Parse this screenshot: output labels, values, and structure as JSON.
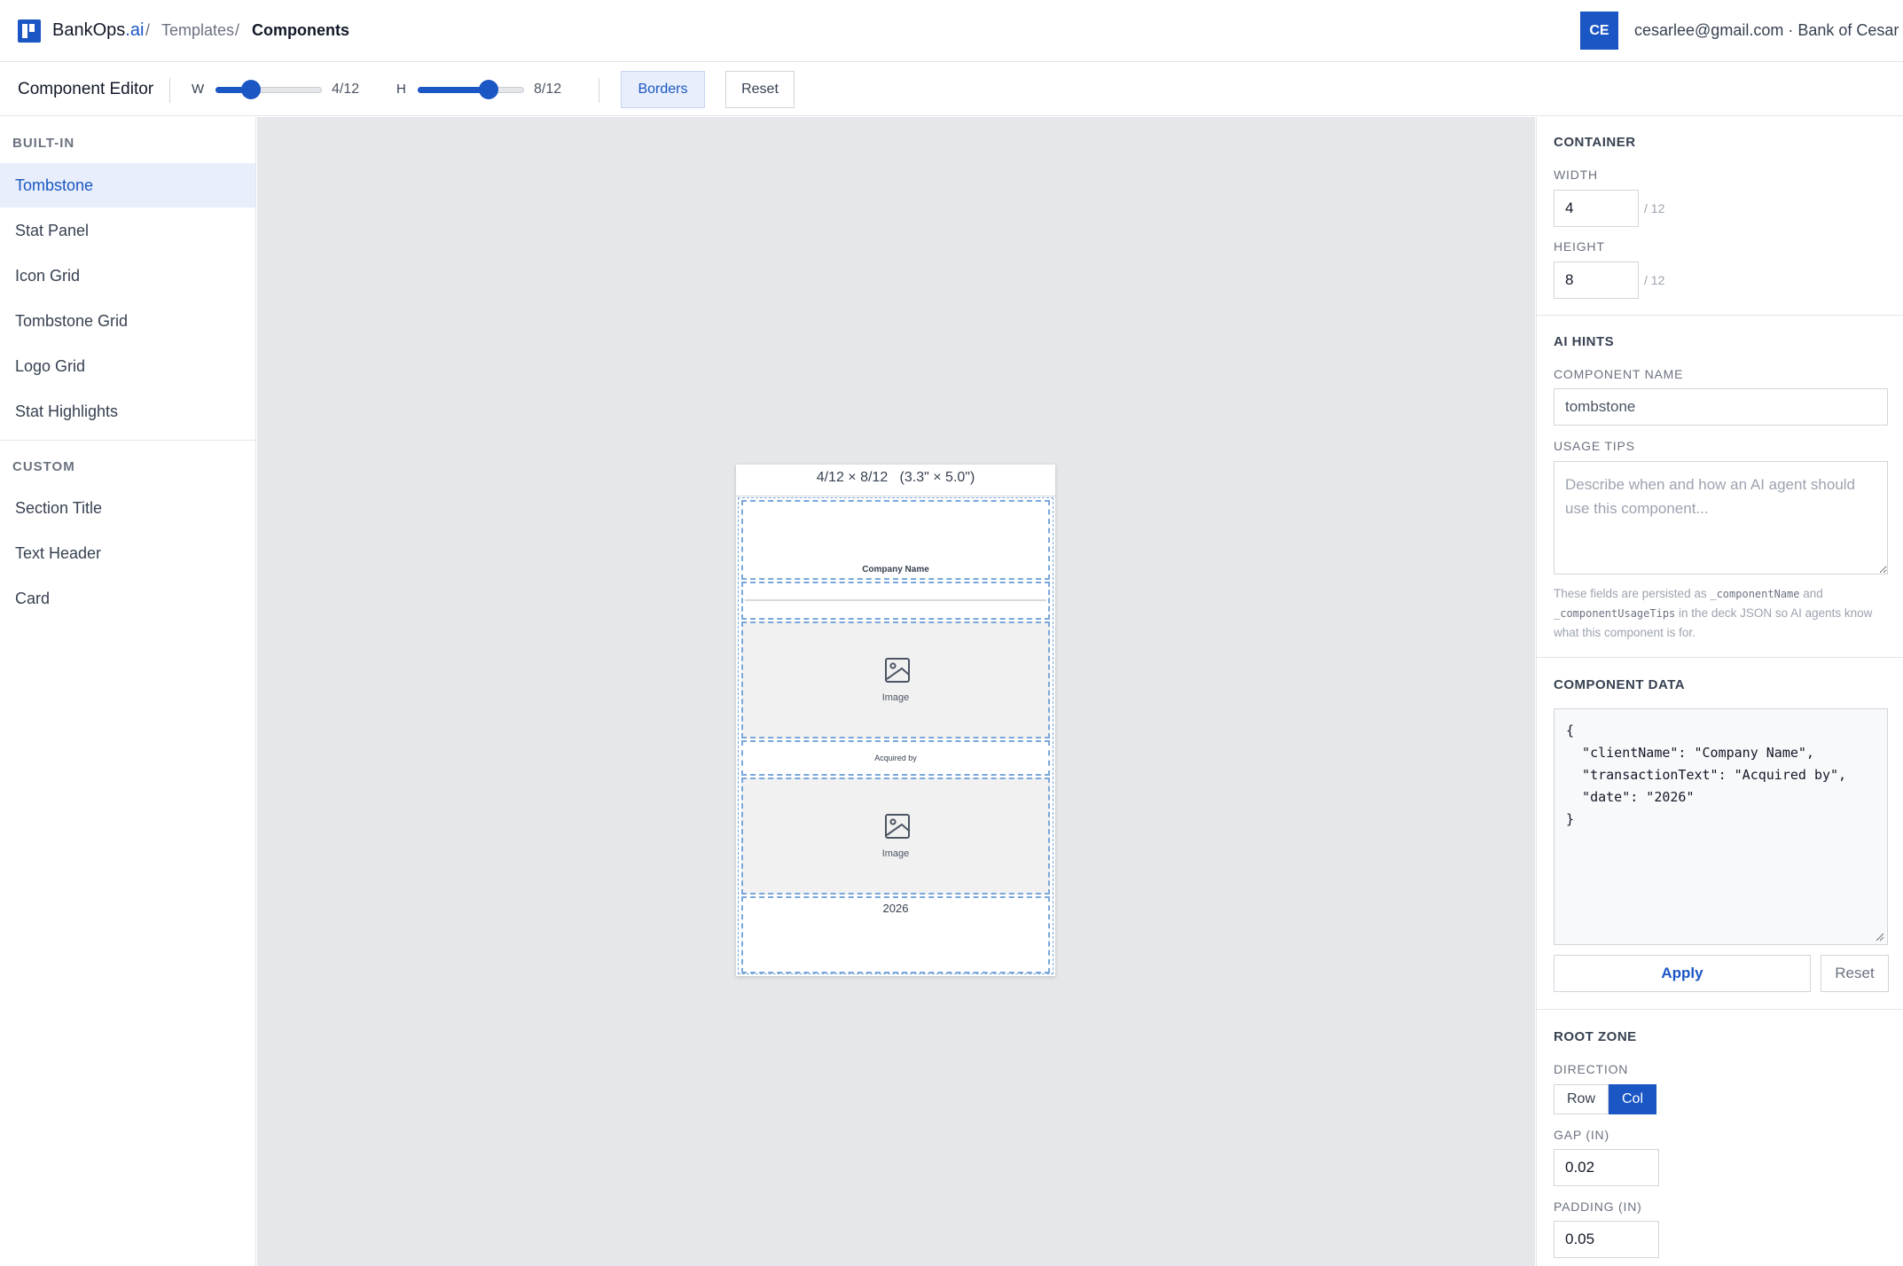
{
  "header": {
    "brand_main": "BankOps",
    "brand_accent": ".ai",
    "crumb_sep": "/",
    "breadcrumbs": [
      "Templates",
      "Components"
    ],
    "avatar_initials": "CE",
    "user_line": "cesarlee@gmail.com · Bank of Cesar"
  },
  "toolbar": {
    "title": "Component Editor",
    "width_label": "W",
    "width_value": "4/12",
    "width_fraction": 0.333,
    "height_label": "H",
    "height_value": "8/12",
    "height_fraction": 0.667,
    "borders_label": "Borders",
    "reset_label": "Reset"
  },
  "sidebar": {
    "builtin_heading": "BUILT-IN",
    "builtin_items": [
      "Tombstone",
      "Stat Panel",
      "Icon Grid",
      "Tombstone Grid",
      "Logo Grid",
      "Stat Highlights"
    ],
    "active_item": "Tombstone",
    "custom_heading": "CUSTOM",
    "custom_items": [
      "Section Title",
      "Text Header",
      "Card"
    ]
  },
  "canvas": {
    "card_header": "4/12 × 8/12   (3.3\" × 5.0\")",
    "company_name": "Company Name",
    "image_label_1": "Image",
    "acquired_text": "Acquired by",
    "image_label_2": "Image",
    "date_text": "2026"
  },
  "panel": {
    "container": {
      "heading": "CONTAINER",
      "width_label": "WIDTH",
      "width_value": "4",
      "width_unit": "/ 12",
      "height_label": "HEIGHT",
      "height_value": "8",
      "height_unit": "/ 12"
    },
    "ai_hints": {
      "heading": "AI HINTS",
      "name_label": "COMPONENT NAME",
      "name_value": "tombstone",
      "tips_label": "USAGE TIPS",
      "tips_placeholder": "Describe when and how an AI agent should use this component...",
      "note_1": "These fields are persisted as",
      "note_code_1": "_componentName",
      "note_2": "and",
      "note_code_2": "_componentUsageTips",
      "note_3": "in the deck JSON so AI agents know what this component is for."
    },
    "component_data": {
      "heading": "COMPONENT DATA",
      "json_text": "{\n  \"clientName\": \"Company Name\",\n  \"transactionText\": \"Acquired by\",\n  \"date\": \"2026\"\n}",
      "apply_label": "Apply",
      "reset_label": "Reset"
    },
    "root_zone": {
      "heading": "ROOT ZONE",
      "direction_label": "DIRECTION",
      "direction_options": [
        "Row",
        "Col"
      ],
      "direction_selected": "Col",
      "gap_label": "GAP (IN)",
      "gap_value": "0.02",
      "padding_label": "PADDING (IN)",
      "padding_value": "0.05"
    }
  },
  "colors": {
    "accent": "#1a56c4",
    "zone_border": "#7aa7da",
    "canvas_bg": "#e5e7eb"
  },
  "icons": [
    "image-icon"
  ]
}
